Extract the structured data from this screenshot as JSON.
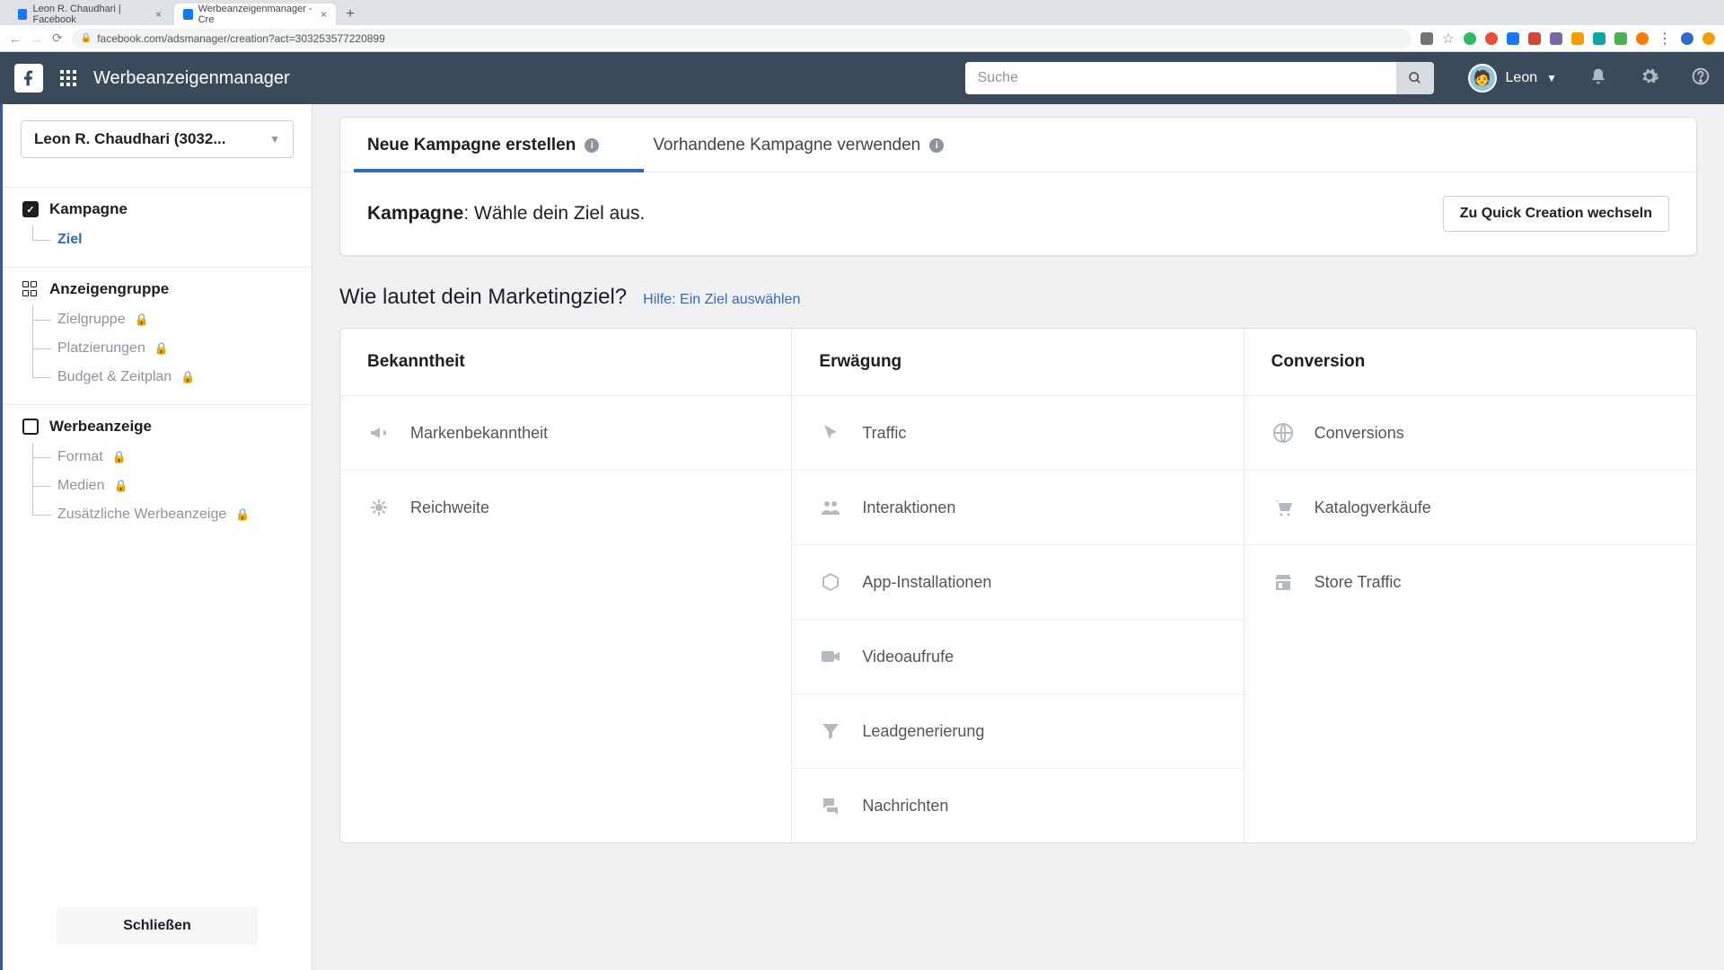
{
  "browser": {
    "tabs": [
      {
        "title": "Leon R. Chaudhari | Facebook",
        "favicon": "#1877f2"
      },
      {
        "title": "Werbeanzeigenmanager - Cre",
        "favicon": "#1877f2"
      }
    ],
    "url": "facebook.com/adsmanager/creation?act=303253577220899"
  },
  "header": {
    "app_title": "Werbeanzeigenmanager",
    "search_placeholder": "Suche",
    "user_name": "Leon"
  },
  "sidebar": {
    "account": "Leon R. Chaudhari (3032...",
    "sections": {
      "campaign": {
        "title": "Kampagne",
        "items": [
          "Ziel"
        ]
      },
      "adset": {
        "title": "Anzeigengruppe",
        "items": [
          "Zielgruppe",
          "Platzierungen",
          "Budget & Zeitplan"
        ]
      },
      "ad": {
        "title": "Werbeanzeige",
        "items": [
          "Format",
          "Medien",
          "Zusätzliche Werbeanzeige"
        ]
      }
    },
    "close_label": "Schließen"
  },
  "main": {
    "tab_new": "Neue Kampagne erstellen",
    "tab_existing": "Vorhandene Kampagne verwenden",
    "prompt_bold": "Kampagne",
    "prompt_rest": ": Wähle dein Ziel aus.",
    "quick_btn": "Zu Quick Creation wechseln",
    "question": "Wie lautet dein Marketingziel?",
    "help": "Hilfe: Ein Ziel auswählen",
    "columns": {
      "awareness": {
        "head": "Bekanntheit",
        "items": [
          "Markenbekanntheit",
          "Reichweite"
        ]
      },
      "consideration": {
        "head": "Erwägung",
        "items": [
          "Traffic",
          "Interaktionen",
          "App-Installationen",
          "Videoaufrufe",
          "Leadgenerierung",
          "Nachrichten"
        ]
      },
      "conversion": {
        "head": "Conversion",
        "items": [
          "Conversions",
          "Katalogverkäufe",
          "Store Traffic"
        ]
      }
    }
  }
}
